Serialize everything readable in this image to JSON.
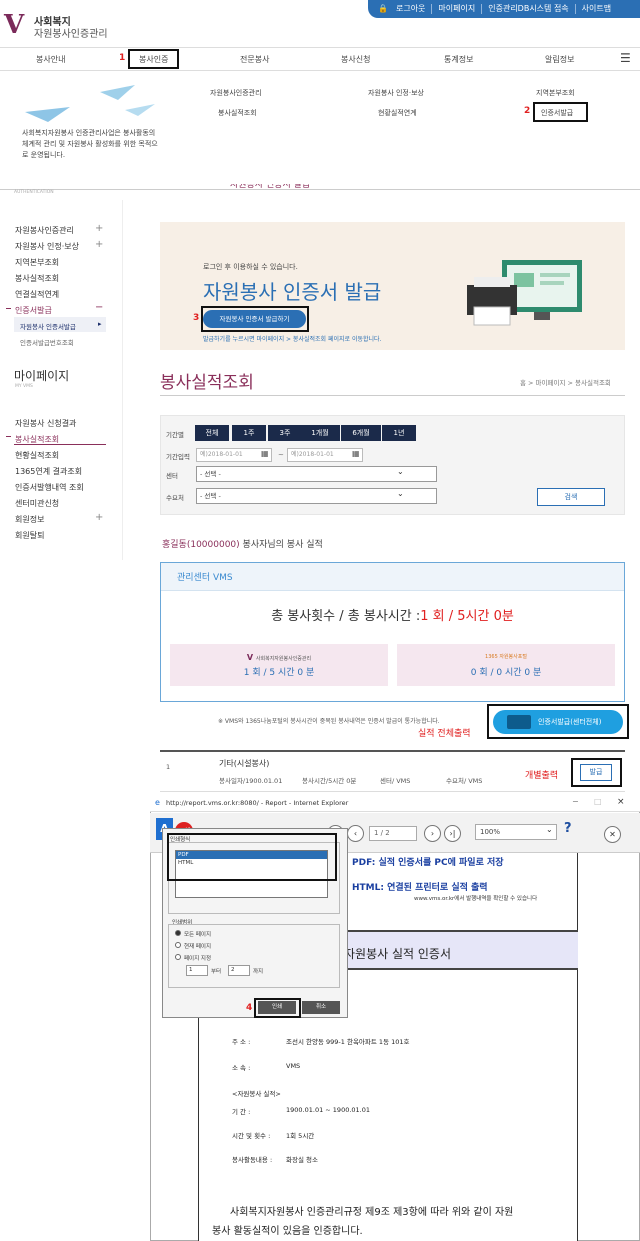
{
  "header": {
    "logo_line1": "사회복지",
    "logo_line2": "자원봉사인증관리",
    "util": [
      "로그아웃",
      "마이페이지",
      "인증관리DB시스템 접속",
      "사이트맵"
    ]
  },
  "gnb": [
    "봉사안내",
    "봉사인증",
    "전문봉사",
    "봉사신청",
    "통계정보",
    "알림정보"
  ],
  "steps": {
    "s1": "1",
    "s2": "2",
    "s3": "3",
    "s4": "4"
  },
  "mega": {
    "col1": [
      "자원봉사인증관리",
      "봉사실적조회"
    ],
    "col2": [
      "자원봉사 인정·보상",
      "현황실적연계"
    ],
    "col3": [
      "지역본부조회",
      "인증서발급"
    ],
    "desc": "사회복지자원봉사 인증관리사업은 봉사활동의 체계적 관리 및 자원봉사 활성화를 위한 목적으로 운영됩니다.",
    "auth": "AUTHENTICATION",
    "peek": "자원봉사 인증서 발급"
  },
  "lnb": {
    "items": [
      "자원봉사인증관리",
      "자원봉사 인정·보상",
      "지역본부조회",
      "봉사실적조회",
      "연결실적연계",
      "인증서발급"
    ],
    "sub": [
      "자원봉사 인증서발급",
      "인증서발급번호조회"
    ],
    "my_title": "마이페이지",
    "my_sub": "MY VMS",
    "my_items": [
      "자원봉사 신청결과",
      "봉사실적조회",
      "현황실적조회",
      "1365연계 결과조회",
      "인증서발행내역 조회",
      "센터미관신청",
      "회원정보",
      "회원탈퇴"
    ]
  },
  "banner": {
    "small": "로그인 후 이용하실 수 있습니다.",
    "title": "자원봉사 인증서 발급",
    "button": "자원봉사 인증서 발급하기",
    "note": "발급하기를 누르시면 마이페이지 > 봉사실적조회 페이지로 이동합니다."
  },
  "page": {
    "title": "봉사실적조회",
    "breadcrumb": "홈 > 마이페이지 > 봉사실적조회"
  },
  "filter": {
    "period_label": "기간별",
    "periods": [
      "전체",
      "1주",
      "3주",
      "1개월",
      "6개월",
      "1년"
    ],
    "date_label": "기간입력",
    "date_from": "예)2018-01-01",
    "date_to": "예)2018-01-01",
    "center_label": "센터",
    "center_value": "- 선택 -",
    "demand_label": "수요처",
    "demand_value": "- 선택 -",
    "search": "검색"
  },
  "user_line": {
    "name": "홍길동(10000000)",
    "rest": " 봉사자님의 봉사 실적"
  },
  "summary": {
    "head": "관리센터 VMS",
    "total": "총 봉사횟수 / 총 봉사시간 :",
    "total_val": "1 회 / 5시간 0분",
    "box1_label": "사회복지자원봉사인증관리",
    "box1_val": "1 회 / 5 시간 0 분",
    "box2_label": "1365 자원봉사포털",
    "box2_val": "0 회 / 0 시간 0 분"
  },
  "notice": "※ VMS와 1365나눔포털의 봉사시간이 중복된 봉사내역은 인증서 발급이 통가능합니다.",
  "all_print": {
    "red": "실적 전체출력",
    "btn": "인증서발급(센터전체)"
  },
  "row": {
    "no": "1",
    "title": "기타(시설봉사)",
    "date": "봉사일자/1900.01.01",
    "hours": "봉사시간/5시간 0분",
    "center": "센터/ VMS",
    "demand": "수요처/ VMS",
    "red": "개별출력",
    "btn": "발급"
  },
  "ie": {
    "title": "http://report.vms.or.kr:8080/ - Report - Internet Explorer",
    "page": "1    / 2",
    "zoom": "100%"
  },
  "report": {
    "pdf_note": "PDF: 실적 인증서를 PC에 파일로 저장",
    "html_note": "HTML: 연결된 프린터로 실적 출력",
    "site": "www.vms.or.kr에서 발행내역을 확인할 수 있습니다",
    "title": "자원봉사 실적 인증서",
    "addr_l": "주         소 :",
    "addr_v": "조선시 한양동 999-1 한옥아파트 1동 101호",
    "org_l": "소         속 :",
    "org_v": "VMS",
    "section": "<자원봉사 실적>",
    "period_l": "기         간 :",
    "period_v": "1900.01.01 ~ 1900.01.01",
    "hours_l": "시간 및 횟수 :",
    "hours_v": "1회 5시간",
    "place_l": "봉사활동내용 :",
    "place_v": "화장실 청소",
    "cert1": "사회복지자원봉사 인증관리규정 제9조 제3항에 따라 위와 같이 자원",
    "cert2": "봉사 활동실적이 있음을 인증합니다."
  },
  "dialog": {
    "fmt_label": "인쇄형식",
    "fmt1": "PDF",
    "fmt2": "HTML",
    "range_label": "인쇄범위",
    "r1": "모든 페이지",
    "r2": "현재 페이지",
    "r3": "페이지 지정",
    "from": "1",
    "from_l": "부터",
    "to": "2",
    "to_l": "까지",
    "print": "인쇄",
    "cancel": "취소"
  },
  "colors": {
    "brand": "#7b2a5a",
    "blue": "#2b6fb4",
    "red": "#e02020"
  }
}
